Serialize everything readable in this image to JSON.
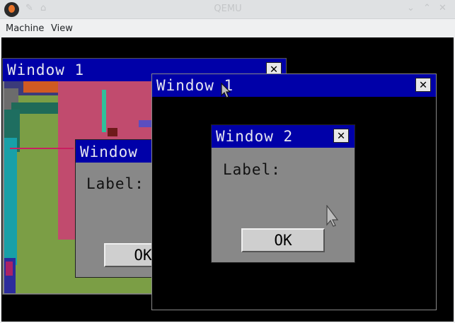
{
  "window": {
    "title": "QEMU"
  },
  "menubar": {
    "items": [
      "Machine",
      "View"
    ]
  },
  "guest": {
    "window1_back": {
      "title": "Window 1"
    },
    "window1_front": {
      "title": "Window 1"
    },
    "dialog_back": {
      "title": "Window",
      "label": "Label:",
      "ok": "OK"
    },
    "window2": {
      "title": "Window 2",
      "label": "Label:",
      "ok": "OK"
    }
  },
  "colors": {
    "guest_titlebar": "#0000a8",
    "guest_panel": "#7f7f7f",
    "screen_bg": "#000000"
  }
}
